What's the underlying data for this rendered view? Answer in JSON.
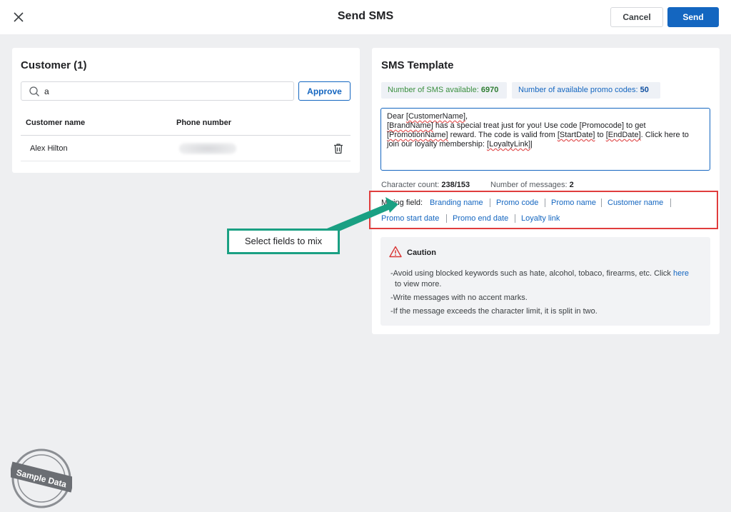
{
  "header": {
    "title": "Send SMS",
    "cancel_label": "Cancel",
    "send_label": "Send"
  },
  "customer_panel": {
    "title": "Customer (1)",
    "search_value": "a",
    "approve_label": "Approve",
    "columns": [
      "Customer name",
      "Phone number"
    ],
    "rows": [
      {
        "name": "Alex Hilton"
      }
    ]
  },
  "sms_panel": {
    "title": "SMS Template",
    "sms_available_label": "Number of SMS available:",
    "sms_available_value": "6970",
    "promo_codes_label": "Number of available promo codes:",
    "promo_codes_value": "50",
    "message": {
      "l1a": "Dear ",
      "l1b": "[CustomerName]",
      "l1c": ",",
      "l2a": "[BrandName]",
      "l2b": " has a special treat just for you! Use code [Promocode] to get",
      "l3a": "[PromotionName]",
      "l3b": " reward. The code is valid from ",
      "l3c": "[StartDate]",
      "l3d": " to ",
      "l3e": "[EndDate]",
      "l3f": ". Click here to",
      "l4a": "join our loyalty membership: ",
      "l4b": "[LoyaltyLink]"
    },
    "char_count_label": "Character count:",
    "char_count_value": "238/153",
    "msg_count_label": "Number of messages:",
    "msg_count_value": "2",
    "mixing_label": "Mixing field:",
    "mixing_fields": [
      "Branding name",
      "Promo code",
      "Promo name",
      "Customer name",
      "Promo start date",
      "Promo end date",
      "Loyalty link"
    ],
    "caution": {
      "title": "Caution",
      "b1a": "-Avoid using blocked keywords such as hate, alcohol, tobaco, firearms, etc. Click ",
      "b1_link": "here",
      "b1b": "to view more.",
      "b2": "-Write messages with no accent marks.",
      "b3": "-If the message exceeds the character limit, it is split in two."
    }
  },
  "annotation": {
    "callout_text": "Select fields to mix",
    "stamp_text": "Sample Data"
  },
  "colors": {
    "primary": "#1466c0",
    "highlight": "#e03d3d",
    "callout": "#1aa083",
    "success": "#2e7d32"
  }
}
